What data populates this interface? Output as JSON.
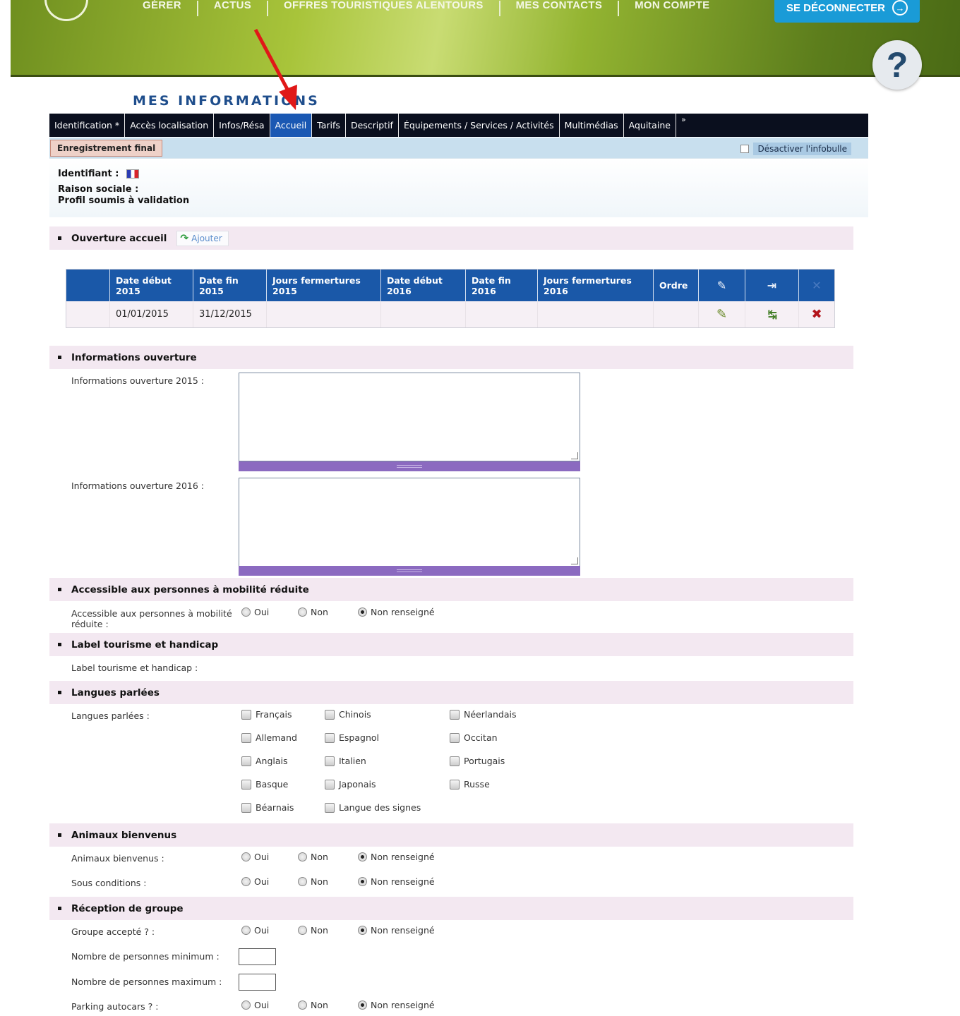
{
  "header": {
    "nav": [
      "GÉRER",
      "ACTUS",
      "OFFRES TOURISTIQUES ALENTOURS",
      "MES CONTACTS",
      "MON COMPTE"
    ],
    "logout_label": "SE DÉCONNECTER",
    "help_label": "?"
  },
  "page_title": "MES INFORMATIONS",
  "tabs": [
    "Identification *",
    "Accès localisation",
    "Infos/Résa",
    "Accueil",
    "Tarifs",
    "Descriptif",
    "Équipements / Services / Activités",
    "Multimédias",
    "Aquitaine",
    "»"
  ],
  "active_tab": "Accueil",
  "toolbar": {
    "save_label": "Enregistrement final",
    "tooltip_label": "Désactiver l'infobulle"
  },
  "ident": {
    "identifiant": "Identifiant :",
    "raison": "Raison sociale :",
    "profil": "Profil soumis à validation"
  },
  "sections": {
    "ouverture_accueil": "Ouverture accueil",
    "add_label": "Ajouter",
    "informations_ouverture": "Informations ouverture",
    "accessible": "Accessible aux personnes à mobilité réduite",
    "label_tourisme": "Label tourisme et handicap",
    "langues": "Langues parlées",
    "animaux": "Animaux bienvenus",
    "groupe": "Réception de groupe"
  },
  "table": {
    "headers": [
      [
        "Date début",
        "2015"
      ],
      [
        "Date fin",
        "2015"
      ],
      [
        "Jours fermertures",
        "2015"
      ],
      [
        "Date début",
        "2016"
      ],
      [
        "Date fin",
        "2016"
      ],
      [
        "Jours fermertures",
        "2016"
      ],
      [
        "Ordre",
        ""
      ]
    ],
    "rows": [
      {
        "debut_2015": "01/01/2015",
        "fin_2015": "31/12/2015"
      }
    ]
  },
  "fields": {
    "info_2015": "Informations ouverture 2015 :",
    "info_2016": "Informations ouverture 2016 :",
    "accessible_label_1": "Accessible aux personnes à mobilité",
    "accessible_label_2": "réduite :",
    "label_tourisme": "Label tourisme et handicap :",
    "langues": "Langues parlées :",
    "animaux": "Animaux bienvenus :",
    "sous_conditions": "Sous conditions :",
    "groupe_accepte": "Groupe accepté ? :",
    "min": "Nombre de personnes minimum :",
    "max": "Nombre de personnes maximum :",
    "parking": "Parking autocars ? :"
  },
  "radio_options": [
    "Oui",
    "Non",
    "Non renseigné"
  ],
  "languages": [
    [
      "Français",
      "Chinois",
      "Néerlandais"
    ],
    [
      "Allemand",
      "Espagnol",
      "Occitan"
    ],
    [
      "Anglais",
      "Italien",
      "Portugais"
    ],
    [
      "Basque",
      "Japonais",
      "Russe"
    ],
    [
      "Béarnais",
      "Langue des signes",
      ""
    ]
  ],
  "colors": {
    "tab_bar": "#0a0f1e",
    "tab_active": "#1a58b3",
    "section_bg": "#f3e8f1",
    "table_head": "#1a58a8",
    "logout": "#1a9bd7"
  }
}
